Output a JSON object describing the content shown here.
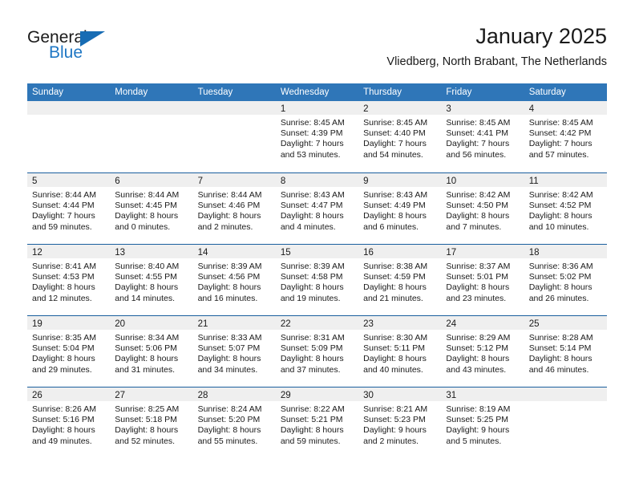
{
  "brand": {
    "word1": "General",
    "word2": "Blue",
    "triangle_color": "#176cb4",
    "blue_color": "#1f77c4"
  },
  "header": {
    "title": "January 2025",
    "subtitle": "Vliedberg, North Brabant, The Netherlands"
  },
  "theme": {
    "header_row_bg": "#2f76b8",
    "week_divider": "#1a5f9e",
    "daynum_band_bg": "#efefef"
  },
  "calendar": {
    "weekdays": [
      "Sunday",
      "Monday",
      "Tuesday",
      "Wednesday",
      "Thursday",
      "Friday",
      "Saturday"
    ],
    "weeks": [
      [
        {
          "day": "",
          "empty": true
        },
        {
          "day": "",
          "empty": true
        },
        {
          "day": "",
          "empty": true
        },
        {
          "day": "1",
          "sunrise": "Sunrise: 8:45 AM",
          "sunset": "Sunset: 4:39 PM",
          "daylight_1": "Daylight: 7 hours",
          "daylight_2": "and 53 minutes."
        },
        {
          "day": "2",
          "sunrise": "Sunrise: 8:45 AM",
          "sunset": "Sunset: 4:40 PM",
          "daylight_1": "Daylight: 7 hours",
          "daylight_2": "and 54 minutes."
        },
        {
          "day": "3",
          "sunrise": "Sunrise: 8:45 AM",
          "sunset": "Sunset: 4:41 PM",
          "daylight_1": "Daylight: 7 hours",
          "daylight_2": "and 56 minutes."
        },
        {
          "day": "4",
          "sunrise": "Sunrise: 8:45 AM",
          "sunset": "Sunset: 4:42 PM",
          "daylight_1": "Daylight: 7 hours",
          "daylight_2": "and 57 minutes."
        }
      ],
      [
        {
          "day": "5",
          "sunrise": "Sunrise: 8:44 AM",
          "sunset": "Sunset: 4:44 PM",
          "daylight_1": "Daylight: 7 hours",
          "daylight_2": "and 59 minutes."
        },
        {
          "day": "6",
          "sunrise": "Sunrise: 8:44 AM",
          "sunset": "Sunset: 4:45 PM",
          "daylight_1": "Daylight: 8 hours",
          "daylight_2": "and 0 minutes."
        },
        {
          "day": "7",
          "sunrise": "Sunrise: 8:44 AM",
          "sunset": "Sunset: 4:46 PM",
          "daylight_1": "Daylight: 8 hours",
          "daylight_2": "and 2 minutes."
        },
        {
          "day": "8",
          "sunrise": "Sunrise: 8:43 AM",
          "sunset": "Sunset: 4:47 PM",
          "daylight_1": "Daylight: 8 hours",
          "daylight_2": "and 4 minutes."
        },
        {
          "day": "9",
          "sunrise": "Sunrise: 8:43 AM",
          "sunset": "Sunset: 4:49 PM",
          "daylight_1": "Daylight: 8 hours",
          "daylight_2": "and 6 minutes."
        },
        {
          "day": "10",
          "sunrise": "Sunrise: 8:42 AM",
          "sunset": "Sunset: 4:50 PM",
          "daylight_1": "Daylight: 8 hours",
          "daylight_2": "and 7 minutes."
        },
        {
          "day": "11",
          "sunrise": "Sunrise: 8:42 AM",
          "sunset": "Sunset: 4:52 PM",
          "daylight_1": "Daylight: 8 hours",
          "daylight_2": "and 10 minutes."
        }
      ],
      [
        {
          "day": "12",
          "sunrise": "Sunrise: 8:41 AM",
          "sunset": "Sunset: 4:53 PM",
          "daylight_1": "Daylight: 8 hours",
          "daylight_2": "and 12 minutes."
        },
        {
          "day": "13",
          "sunrise": "Sunrise: 8:40 AM",
          "sunset": "Sunset: 4:55 PM",
          "daylight_1": "Daylight: 8 hours",
          "daylight_2": "and 14 minutes."
        },
        {
          "day": "14",
          "sunrise": "Sunrise: 8:39 AM",
          "sunset": "Sunset: 4:56 PM",
          "daylight_1": "Daylight: 8 hours",
          "daylight_2": "and 16 minutes."
        },
        {
          "day": "15",
          "sunrise": "Sunrise: 8:39 AM",
          "sunset": "Sunset: 4:58 PM",
          "daylight_1": "Daylight: 8 hours",
          "daylight_2": "and 19 minutes."
        },
        {
          "day": "16",
          "sunrise": "Sunrise: 8:38 AM",
          "sunset": "Sunset: 4:59 PM",
          "daylight_1": "Daylight: 8 hours",
          "daylight_2": "and 21 minutes."
        },
        {
          "day": "17",
          "sunrise": "Sunrise: 8:37 AM",
          "sunset": "Sunset: 5:01 PM",
          "daylight_1": "Daylight: 8 hours",
          "daylight_2": "and 23 minutes."
        },
        {
          "day": "18",
          "sunrise": "Sunrise: 8:36 AM",
          "sunset": "Sunset: 5:02 PM",
          "daylight_1": "Daylight: 8 hours",
          "daylight_2": "and 26 minutes."
        }
      ],
      [
        {
          "day": "19",
          "sunrise": "Sunrise: 8:35 AM",
          "sunset": "Sunset: 5:04 PM",
          "daylight_1": "Daylight: 8 hours",
          "daylight_2": "and 29 minutes."
        },
        {
          "day": "20",
          "sunrise": "Sunrise: 8:34 AM",
          "sunset": "Sunset: 5:06 PM",
          "daylight_1": "Daylight: 8 hours",
          "daylight_2": "and 31 minutes."
        },
        {
          "day": "21",
          "sunrise": "Sunrise: 8:33 AM",
          "sunset": "Sunset: 5:07 PM",
          "daylight_1": "Daylight: 8 hours",
          "daylight_2": "and 34 minutes."
        },
        {
          "day": "22",
          "sunrise": "Sunrise: 8:31 AM",
          "sunset": "Sunset: 5:09 PM",
          "daylight_1": "Daylight: 8 hours",
          "daylight_2": "and 37 minutes."
        },
        {
          "day": "23",
          "sunrise": "Sunrise: 8:30 AM",
          "sunset": "Sunset: 5:11 PM",
          "daylight_1": "Daylight: 8 hours",
          "daylight_2": "and 40 minutes."
        },
        {
          "day": "24",
          "sunrise": "Sunrise: 8:29 AM",
          "sunset": "Sunset: 5:12 PM",
          "daylight_1": "Daylight: 8 hours",
          "daylight_2": "and 43 minutes."
        },
        {
          "day": "25",
          "sunrise": "Sunrise: 8:28 AM",
          "sunset": "Sunset: 5:14 PM",
          "daylight_1": "Daylight: 8 hours",
          "daylight_2": "and 46 minutes."
        }
      ],
      [
        {
          "day": "26",
          "sunrise": "Sunrise: 8:26 AM",
          "sunset": "Sunset: 5:16 PM",
          "daylight_1": "Daylight: 8 hours",
          "daylight_2": "and 49 minutes."
        },
        {
          "day": "27",
          "sunrise": "Sunrise: 8:25 AM",
          "sunset": "Sunset: 5:18 PM",
          "daylight_1": "Daylight: 8 hours",
          "daylight_2": "and 52 minutes."
        },
        {
          "day": "28",
          "sunrise": "Sunrise: 8:24 AM",
          "sunset": "Sunset: 5:20 PM",
          "daylight_1": "Daylight: 8 hours",
          "daylight_2": "and 55 minutes."
        },
        {
          "day": "29",
          "sunrise": "Sunrise: 8:22 AM",
          "sunset": "Sunset: 5:21 PM",
          "daylight_1": "Daylight: 8 hours",
          "daylight_2": "and 59 minutes."
        },
        {
          "day": "30",
          "sunrise": "Sunrise: 8:21 AM",
          "sunset": "Sunset: 5:23 PM",
          "daylight_1": "Daylight: 9 hours",
          "daylight_2": "and 2 minutes."
        },
        {
          "day": "31",
          "sunrise": "Sunrise: 8:19 AM",
          "sunset": "Sunset: 5:25 PM",
          "daylight_1": "Daylight: 9 hours",
          "daylight_2": "and 5 minutes."
        },
        {
          "day": "",
          "empty": true
        }
      ]
    ]
  }
}
